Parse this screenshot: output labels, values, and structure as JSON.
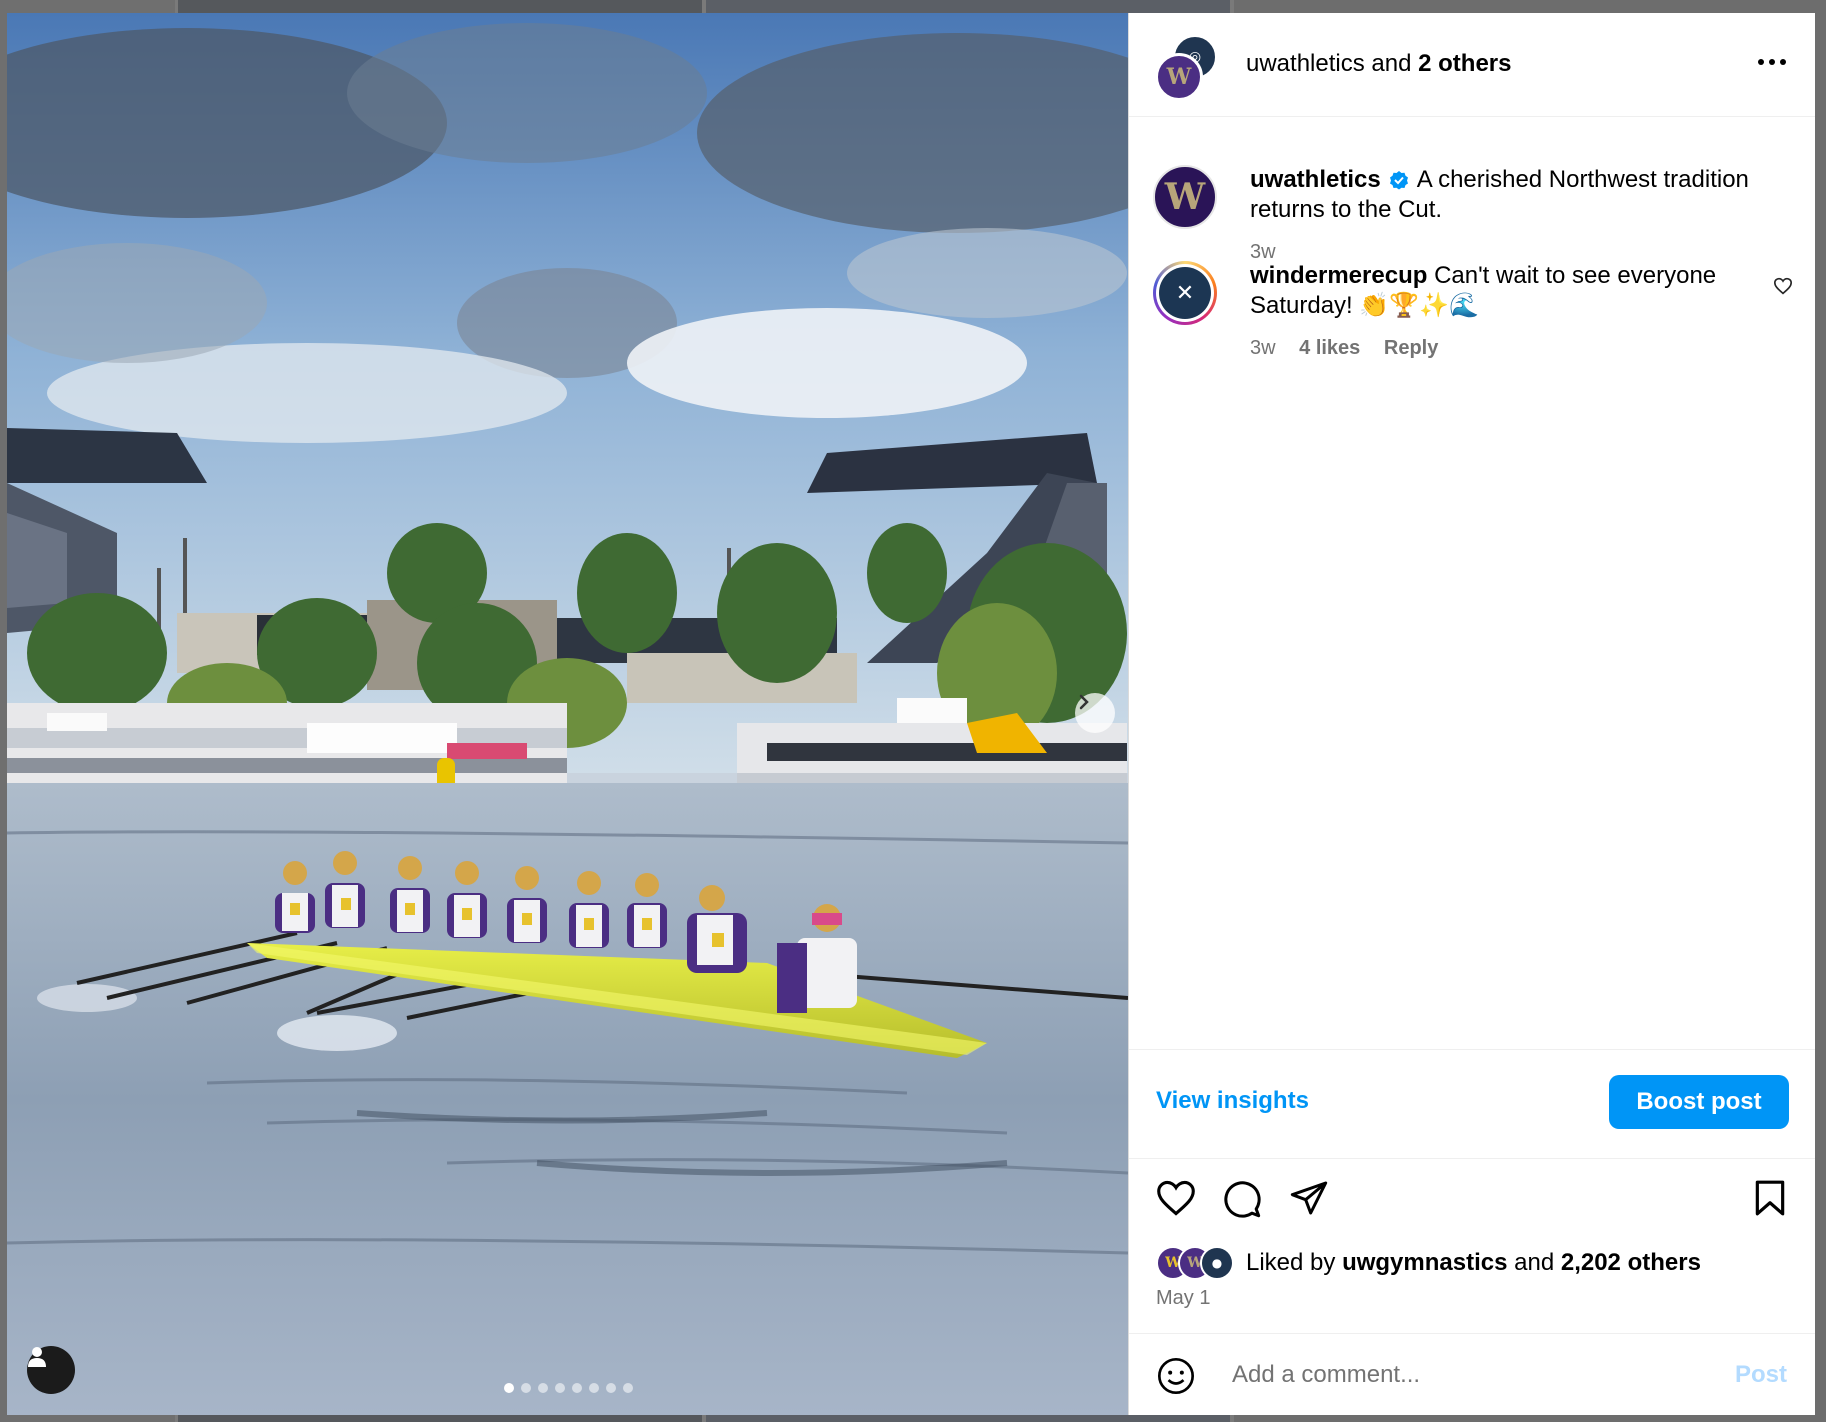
{
  "header": {
    "username": "uwathletics",
    "and_text": " and ",
    "others": "2 others"
  },
  "caption": {
    "username": "uwathletics",
    "text": "A cherished Northwest tradition returns to the Cut.",
    "time": "3w"
  },
  "comment": {
    "username": "windermerecup",
    "text": "Can't wait to see everyone Saturday! 👏🏆✨🌊",
    "time": "3w",
    "likes": "4 likes",
    "reply": "Reply"
  },
  "insights": {
    "view_label": "View insights",
    "boost_label": "Boost post"
  },
  "likes": {
    "prefix": "Liked by ",
    "user": "uwgymnastics",
    "middle": " and ",
    "count": "2,202 others"
  },
  "post_date": "May 1",
  "add_comment": {
    "placeholder": "Add a comment...",
    "post_label": "Post"
  },
  "carousel": {
    "slide_count": 8,
    "active_index": 0
  },
  "colors": {
    "uw_purple": "#4b2e83",
    "link_blue": "#0095f6",
    "boat_yellow": "#d8df3a"
  },
  "icons": [
    "more-icon",
    "verified-icon",
    "heart-icon",
    "comment-icon",
    "share-icon",
    "bookmark-icon",
    "emoji-icon",
    "user-tag-icon",
    "chevron-right-icon"
  ]
}
